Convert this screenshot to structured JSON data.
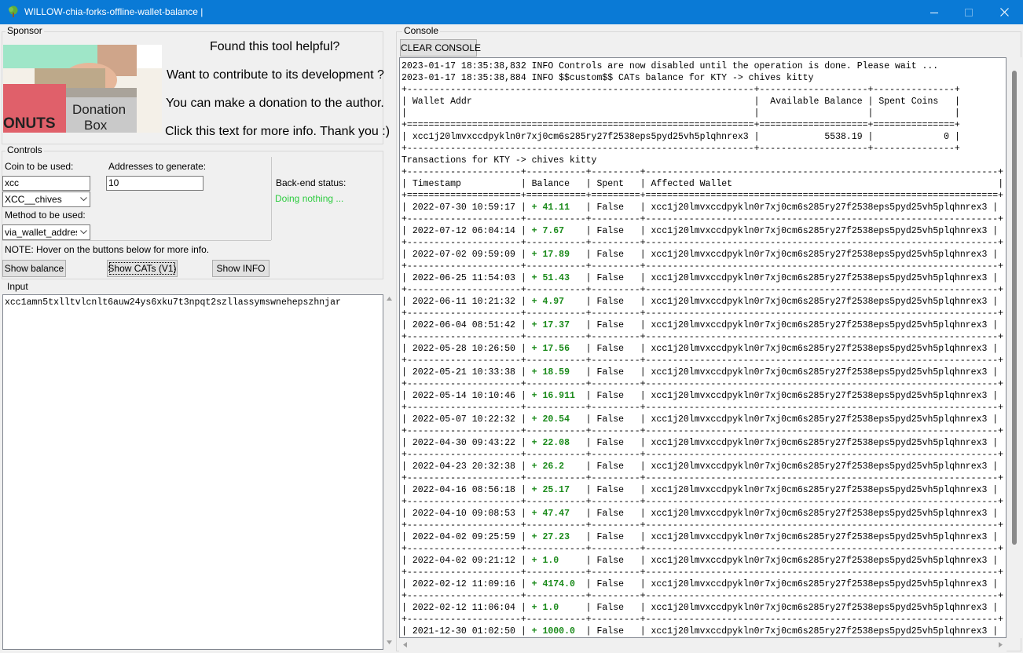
{
  "window": {
    "title": "WILLOW-chia-forks-offline-wallet-balance |",
    "icon": "tree-icon"
  },
  "sponsor": {
    "frame_label": "Sponsor",
    "image_text": [
      "ONUTS",
      "Donation",
      "Box"
    ],
    "lines": [
      "Found this tool helpful?",
      "Want to contribute to its development ?",
      "You can make a donation to the author.",
      "Click this text for more info. Thank you :)"
    ]
  },
  "controls": {
    "frame_label": "Controls",
    "coin_label": "Coin to be used:",
    "coin_value": "xcc",
    "coin_combo": "XCC__chives",
    "addresses_label": "Addresses to generate:",
    "addresses_value": "10",
    "method_label": "Method to be used:",
    "method_combo": "via_wallet_address",
    "status_label": "Back-end status:",
    "status_value": "Doing nothing ...",
    "status_color": "#2ecc40",
    "note": "NOTE: Hover on the buttons below for more info.",
    "btn_balance": "Show balance",
    "btn_cats": "Show CATs (V1)",
    "btn_info": "Show INFO"
  },
  "input": {
    "frame_label": "Input",
    "text": "xcc1amn5txlltvlcnlt6auw24ys6xku7t3npqt2szllassymswnehepszhnjar"
  },
  "console": {
    "frame_label": "Console",
    "clear_button": "CLEAR CONSOLE",
    "log_lines": [
      "2023-01-17 18:35:38,832 INFO Controls are now disabled until the operation is done. Please wait ...",
      "2023-01-17 18:35:38,884 INFO $$custom$$ CATs balance for KTY -> chives kitty"
    ],
    "summary": {
      "headers": [
        "Wallet Addr",
        "Available Balance",
        "Spent Coins"
      ],
      "row": [
        "xcc1j20lmvxccdpykln0r7xj0cm6s285ry27f2538eps5pyd25vh5plqhnrex3",
        "5538.19",
        "0"
      ]
    },
    "tx_title": "Transactions for KTY -> chives kitty",
    "tx_headers": [
      "Timestamp",
      "Balance",
      "Spent",
      "Affected Wallet"
    ],
    "tx_wallet": "xcc1j20lmvxccdpykln0r7xj0cm6s285ry27f2538eps5pyd25vh5plqhnrex3",
    "transactions": [
      {
        "ts": "2022-07-30 10:59:17",
        "bal": "+ 41.11",
        "spent": "False"
      },
      {
        "ts": "2022-07-12 06:04:14",
        "bal": "+ 7.67",
        "spent": "False"
      },
      {
        "ts": "2022-07-02 09:59:09",
        "bal": "+ 17.89",
        "spent": "False"
      },
      {
        "ts": "2022-06-25 11:54:03",
        "bal": "+ 51.43",
        "spent": "False"
      },
      {
        "ts": "2022-06-11 10:21:32",
        "bal": "+ 4.97",
        "spent": "False"
      },
      {
        "ts": "2022-06-04 08:51:42",
        "bal": "+ 17.37",
        "spent": "False"
      },
      {
        "ts": "2022-05-28 10:26:50",
        "bal": "+ 17.56",
        "spent": "False"
      },
      {
        "ts": "2022-05-21 10:33:38",
        "bal": "+ 18.59",
        "spent": "False"
      },
      {
        "ts": "2022-05-14 10:10:46",
        "bal": "+ 16.911",
        "spent": "False"
      },
      {
        "ts": "2022-05-07 10:22:32",
        "bal": "+ 20.54",
        "spent": "False"
      },
      {
        "ts": "2022-04-30 09:43:22",
        "bal": "+ 22.08",
        "spent": "False"
      },
      {
        "ts": "2022-04-23 20:32:38",
        "bal": "+ 26.2",
        "spent": "False"
      },
      {
        "ts": "2022-04-16 08:56:18",
        "bal": "+ 25.17",
        "spent": "False"
      },
      {
        "ts": "2022-04-10 09:08:53",
        "bal": "+ 47.47",
        "spent": "False"
      },
      {
        "ts": "2022-04-02 09:25:59",
        "bal": "+ 27.23",
        "spent": "False"
      },
      {
        "ts": "2022-04-02 09:21:12",
        "bal": "+ 1.0",
        "spent": "False"
      },
      {
        "ts": "2022-02-12 11:09:16",
        "bal": "+ 4174.0",
        "spent": "False"
      },
      {
        "ts": "2022-02-12 11:06:04",
        "bal": "+ 1.0",
        "spent": "False"
      },
      {
        "ts": "2021-12-30 01:02:50",
        "bal": "+ 1000.0",
        "spent": "False"
      }
    ]
  }
}
